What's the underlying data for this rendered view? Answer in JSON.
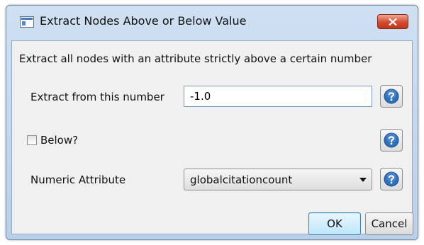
{
  "window": {
    "title": "Extract Nodes Above or Below Value",
    "close_label": "X"
  },
  "dialog": {
    "description": "Extract all nodes with an attribute strictly above a certain number",
    "number_label": "Extract from this number",
    "number_value": "-1.0",
    "below_label": "Below?",
    "below_checked": false,
    "attribute_label": "Numeric Attribute",
    "attribute_selected": "globalcitationcount",
    "help_icon": "question-icon"
  },
  "buttons": {
    "ok": "OK",
    "cancel": "Cancel"
  },
  "colors": {
    "title_bar": "#b9d0ea",
    "close_button": "#c0391d",
    "help_icon": "#2c6fbd",
    "ok_border": "#3c7fb1"
  }
}
